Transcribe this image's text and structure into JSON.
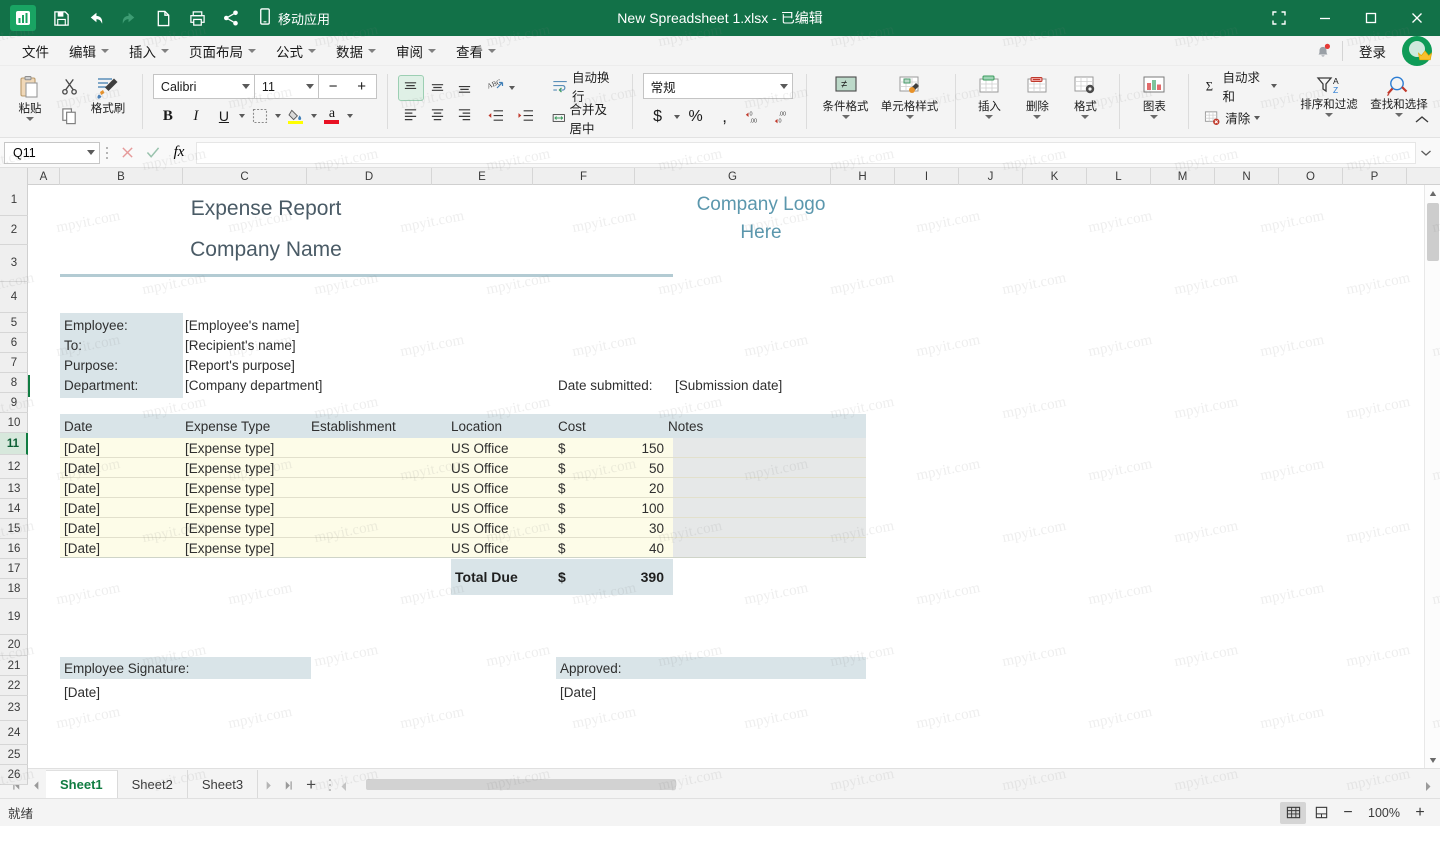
{
  "titlebar": {
    "document_title": "New Spreadsheet 1.xlsx - 已编辑",
    "mobile_app_label": "移动应用",
    "qat": [
      {
        "name": "save-button",
        "label": "保存"
      },
      {
        "name": "undo-button",
        "label": "撤销"
      },
      {
        "name": "redo-button",
        "label": "恢复"
      },
      {
        "name": "new-button",
        "label": "新建"
      },
      {
        "name": "print-button",
        "label": "打印"
      },
      {
        "name": "share-button",
        "label": "共享"
      }
    ],
    "window_controls": [
      {
        "name": "restore-fullscreen-button",
        "label": "全屏"
      },
      {
        "name": "minimize-button",
        "label": "最小化"
      },
      {
        "name": "maximize-button",
        "label": "最大化"
      },
      {
        "name": "close-button",
        "label": "关闭"
      }
    ]
  },
  "menubar": {
    "items": [
      {
        "label": "文件",
        "caret": false
      },
      {
        "label": "编辑",
        "caret": true
      },
      {
        "label": "插入",
        "caret": true
      },
      {
        "label": "页面布局",
        "caret": true
      },
      {
        "label": "公式",
        "caret": true
      },
      {
        "label": "数据",
        "caret": true
      },
      {
        "label": "审阅",
        "caret": true
      },
      {
        "label": "查看",
        "caret": true
      }
    ],
    "signin_label": "登录"
  },
  "ribbon": {
    "clipboard": {
      "paste_label": "粘贴",
      "cut_label": "剪切",
      "copy_label": "复制",
      "format_painter_label": "格式刷"
    },
    "font": {
      "family": "Calibri",
      "size": "11",
      "bold_label": "B",
      "italic_label": "I",
      "underline_label": "U",
      "decrease_label": "−",
      "increase_label": "+"
    },
    "alignment": {
      "wrap_text_label": "自动换行",
      "merge_center_label": "合并及居中"
    },
    "number": {
      "format": "常规"
    },
    "styles": {
      "conditional_format_label": "条件格式",
      "cell_styles_label": "单元格样式"
    },
    "cells": {
      "insert_label": "插入",
      "delete_label": "删除",
      "format_label": "格式"
    },
    "charts": {
      "chart_label": "图表"
    },
    "editing": {
      "autosum_label": "自动求和",
      "clear_label": "清除",
      "sort_filter_label": "排序和过滤",
      "find_select_label": "查找和选择"
    }
  },
  "formulabar": {
    "name_box": "Q11",
    "cancel_label": "取消",
    "accept_label": "输入",
    "function_label": "fx",
    "formula_value": ""
  },
  "grid": {
    "columns": [
      "A",
      "B",
      "C",
      "D",
      "E",
      "F",
      "G",
      "H",
      "I",
      "J",
      "K",
      "L",
      "M",
      "N",
      "O",
      "P"
    ],
    "rows": [
      "1",
      "2",
      "3",
      "4",
      "5",
      "6",
      "7",
      "8",
      "9",
      "10",
      "11",
      "12",
      "13",
      "14",
      "15",
      "16",
      "17",
      "18",
      "19",
      "20",
      "21",
      "22",
      "23",
      "24",
      "25",
      "26"
    ],
    "active_cell": "Q11",
    "active_row": "11"
  },
  "sheet": {
    "title": "Expense Report",
    "company_name": "Company Name",
    "logo_line1": "Company Logo",
    "logo_line2": "Here",
    "info": [
      {
        "label": "Employee:",
        "value": "[Employee's name]"
      },
      {
        "label": "To:",
        "value": "[Recipient's name]"
      },
      {
        "label": "Purpose:",
        "value": "[Report's purpose]"
      },
      {
        "label": "Department:",
        "value": "[Company department]"
      }
    ],
    "date_submitted_label": "Date submitted:",
    "date_submitted_value": "[Submission date]",
    "table": {
      "headers": [
        "Date",
        "Expense Type",
        "Establishment",
        "Location",
        "Cost",
        "Notes"
      ],
      "rows": [
        {
          "date": "[Date]",
          "type": "[Expense type]",
          "establishment": "",
          "location": "US Office",
          "currency": "$",
          "cost": "150",
          "notes": ""
        },
        {
          "date": "[Date]",
          "type": "[Expense type]",
          "establishment": "",
          "location": "US Office",
          "currency": "$",
          "cost": "50",
          "notes": ""
        },
        {
          "date": "[Date]",
          "type": "[Expense type]",
          "establishment": "",
          "location": "US Office",
          "currency": "$",
          "cost": "20",
          "notes": ""
        },
        {
          "date": "[Date]",
          "type": "[Expense type]",
          "establishment": "",
          "location": "US Office",
          "currency": "$",
          "cost": "100",
          "notes": ""
        },
        {
          "date": "[Date]",
          "type": "[Expense type]",
          "establishment": "",
          "location": "US Office",
          "currency": "$",
          "cost": "30",
          "notes": ""
        },
        {
          "date": "[Date]",
          "type": "[Expense type]",
          "establishment": "",
          "location": "US Office",
          "currency": "$",
          "cost": "40",
          "notes": ""
        }
      ],
      "total_label": "Total Due",
      "total_currency": "$",
      "total_value": "390"
    },
    "signature_label": "Employee Signature:",
    "signature_date": "[Date]",
    "approved_label": "Approved:",
    "approved_date": "[Date]"
  },
  "sheettabs": {
    "tabs": [
      "Sheet1",
      "Sheet2",
      "Sheet3"
    ],
    "active": "Sheet1",
    "add_label": "+"
  },
  "statusbar": {
    "status_text": "就绪",
    "zoom_level": "100%",
    "zoom_out_label": "−",
    "zoom_in_label": "+"
  },
  "watermark": {
    "text": "mpyit.com"
  },
  "colors": {
    "brand_green": "#127148",
    "accent_green": "#107c41",
    "table_header_bg": "#d9e4e8",
    "table_row_bg": "#fdfce8",
    "notes_bg": "#e6e8e8",
    "title_text": "#4a5b66",
    "logo_text": "#5b97ad"
  }
}
